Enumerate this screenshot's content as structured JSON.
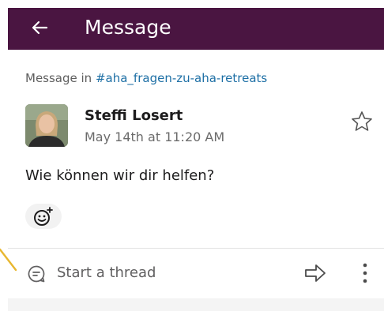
{
  "header": {
    "title": "Message",
    "background": "#4a1541"
  },
  "context": {
    "prefix": "Message in",
    "channel": "#aha_fragen-zu-aha-retreats"
  },
  "message": {
    "author": "Steffi Losert",
    "timestamp": "May 14th at 11:20 AM",
    "text": "Wie können wir dir helfen?"
  },
  "icons": {
    "back": "arrow-left-icon",
    "star": "star-icon",
    "reaction": "add-reaction-icon",
    "thread": "thread-bubble-icon",
    "share": "share-arrow-icon",
    "more": "more-vertical-icon"
  },
  "thread": {
    "label": "Start a thread"
  },
  "colors": {
    "link": "#1d6fa5",
    "pointer": "#e8b730"
  }
}
